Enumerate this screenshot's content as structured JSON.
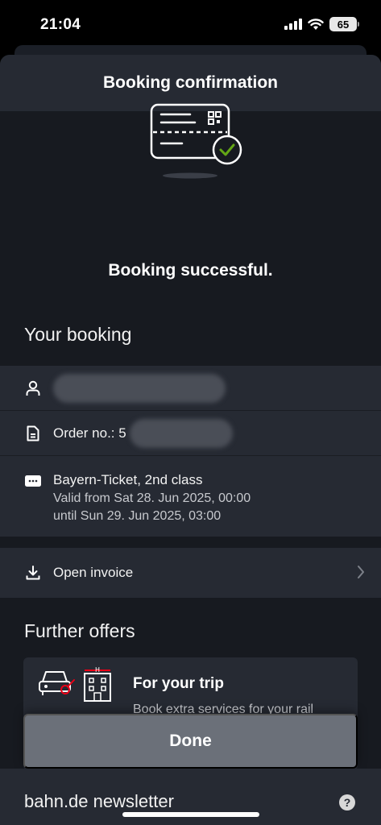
{
  "status_bar": {
    "time": "21:04",
    "battery": "65"
  },
  "header": {
    "title": "Booking confirmation"
  },
  "hero": {
    "message": "Booking successful."
  },
  "booking": {
    "heading": "Your booking",
    "order_label": "Order no.: 5",
    "ticket_name": "Bayern-Ticket, 2nd class",
    "valid_from": "Valid from Sat 28. Jun 2025, 00:00",
    "valid_until": "until Sun 29. Jun 2025, 03:00"
  },
  "invoice": {
    "label": "Open invoice"
  },
  "offers": {
    "heading": "Further offers",
    "card_title": "For your trip",
    "card_desc": "Book extra services for your rail"
  },
  "done_button": {
    "label": "Done"
  },
  "newsletter": {
    "label": "bahn.de newsletter",
    "help": "?"
  },
  "colors": {
    "background": "#171a20",
    "card": "#262a33",
    "accent_red": "#ec0016",
    "check_green": "#63a615",
    "button": "#6b7079"
  }
}
